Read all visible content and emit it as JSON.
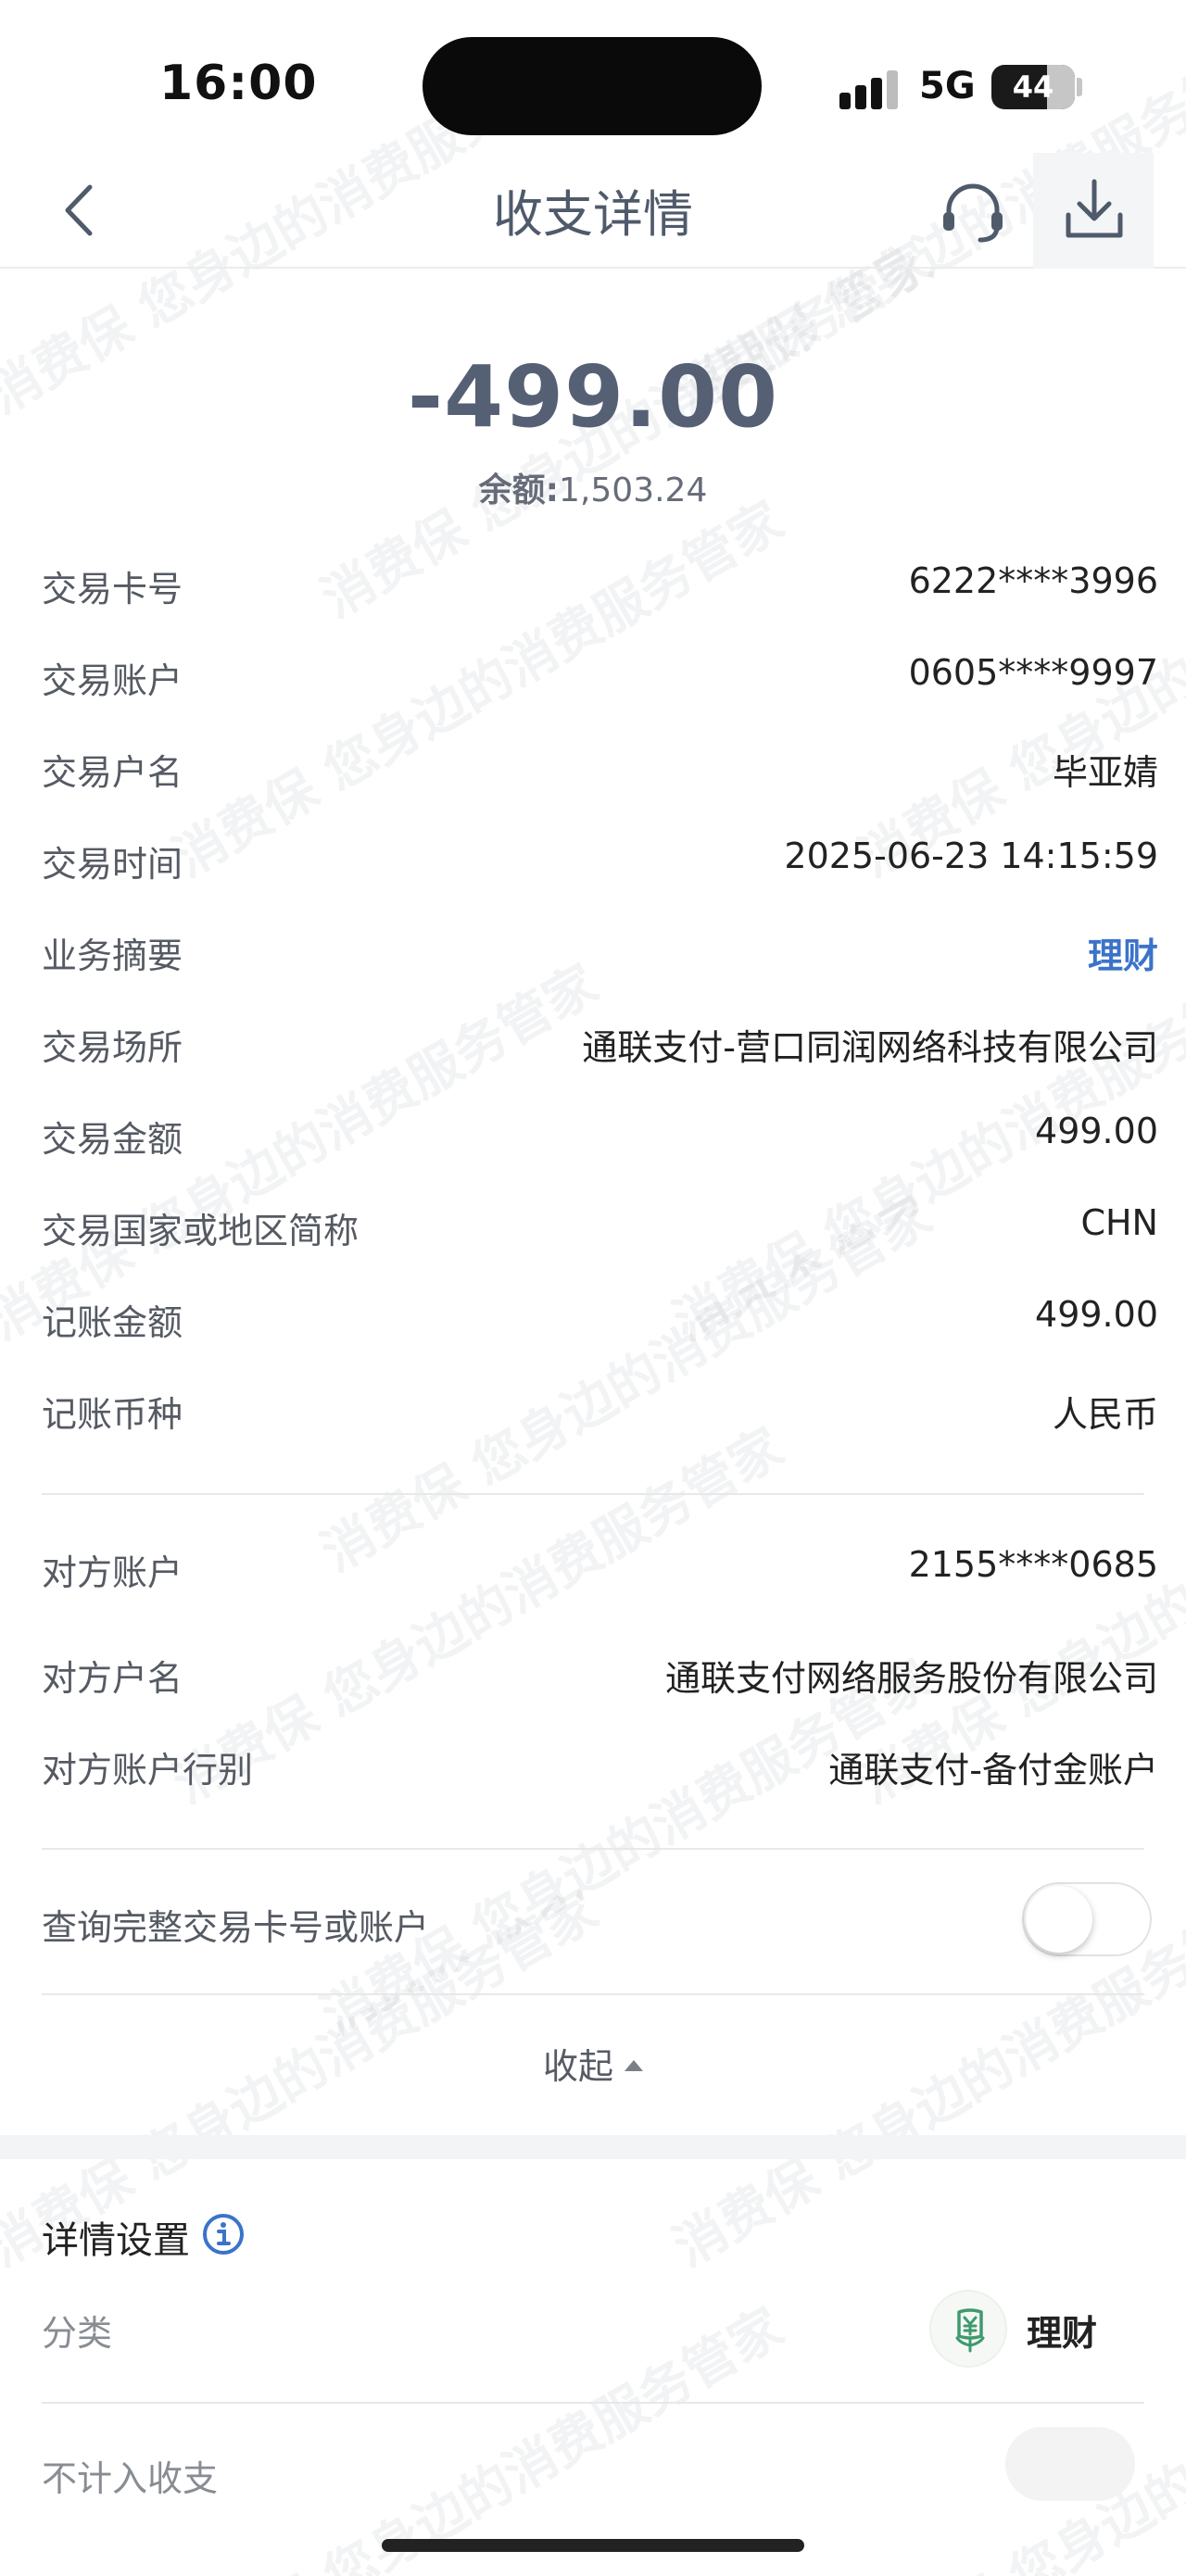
{
  "status_bar": {
    "time": "16:00",
    "network": "5G",
    "battery": "44"
  },
  "nav": {
    "title": "收支详情",
    "back_icon": "chevron-left-icon",
    "service_icon": "headset-icon",
    "download_icon": "download-icon"
  },
  "summary": {
    "amount": "-499.00",
    "balance_label": "余额:",
    "balance_value": "1,503.24"
  },
  "details": [
    {
      "key": "交易卡号",
      "value": "6222****3996"
    },
    {
      "key": "交易账户",
      "value": "0605****9997"
    },
    {
      "key": "交易户名",
      "value": "毕亚婧"
    },
    {
      "key": "交易时间",
      "value": "2025-06-23 14:15:59"
    },
    {
      "key": "业务摘要",
      "value": "理财"
    },
    {
      "key": "交易场所",
      "value": "通联支付-营口同润网络科技有限公司"
    },
    {
      "key": "交易金额",
      "value": "499.00"
    },
    {
      "key": "交易国家或地区简称",
      "value": "CHN"
    },
    {
      "key": "记账金额",
      "value": "499.00"
    },
    {
      "key": "记账币种",
      "value": "人民币"
    }
  ],
  "counterparty": [
    {
      "key": "对方账户",
      "value": "2155****0685"
    },
    {
      "key": "对方户名",
      "value": "通联支付网络服务股份有限公司"
    },
    {
      "key": "对方账户行别",
      "value": "通联支付-备付金账户"
    }
  ],
  "query_full": {
    "label": "查询完整交易卡号或账户",
    "enabled": false
  },
  "collapse_label": "收起",
  "settings": {
    "title": "详情设置",
    "category_label": "分类",
    "category_value": "理财",
    "category_icon": "yuan-plant-icon",
    "exclude_label": "不计入收支",
    "exclude_enabled": false
  },
  "watermark_text": "消费保 您身边的消费服务管家",
  "colors": {
    "accent_link": "#3b73c9",
    "amount": "#566075",
    "category_icon": "#3f9a6e"
  }
}
